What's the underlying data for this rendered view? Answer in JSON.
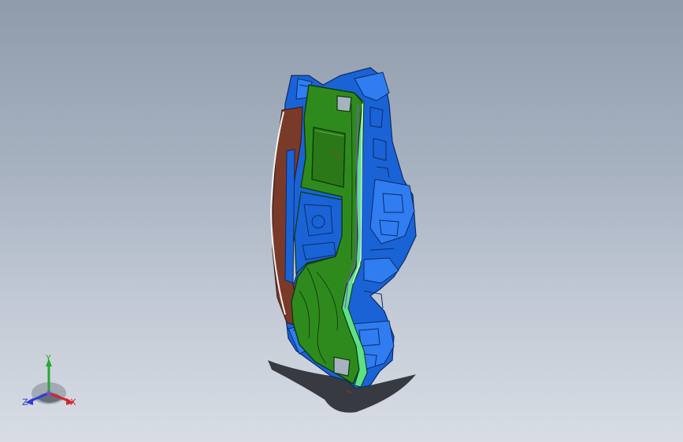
{
  "view": {
    "background_top": "#8f9bab",
    "background_bottom": "#d8dde5",
    "model_colors": {
      "panel_face": "#2f8a1e",
      "structure": "#1a63d6",
      "trim": "#7a3a2a",
      "highlight": "#5ee08a"
    }
  },
  "triad": {
    "y_label": "Y",
    "x_label": "X",
    "z_label": "Z",
    "y_color": "#27a834",
    "x_color": "#d2262b",
    "z_color": "#2b3fd6"
  }
}
